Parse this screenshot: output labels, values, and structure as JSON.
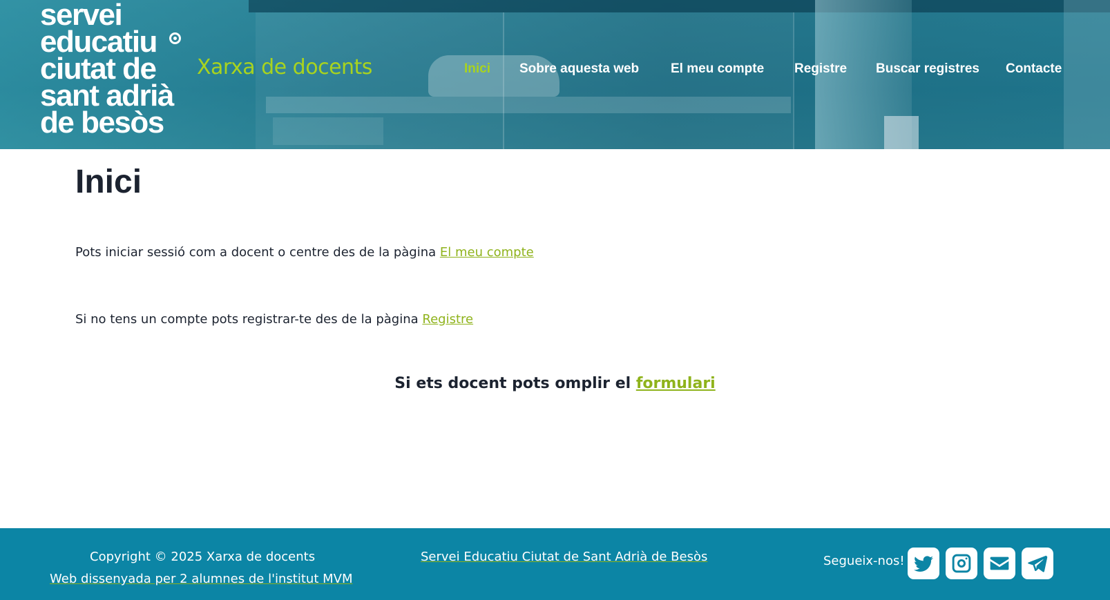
{
  "header": {
    "logo_lines": [
      "servei",
      "educatiu",
      "ciutat de",
      "sant adrià",
      "de besòs"
    ],
    "site_title": "Xarxa de docents",
    "nav": [
      {
        "label": "Inici",
        "active": true
      },
      {
        "label": "Sobre aquesta web",
        "active": false
      },
      {
        "label": "El meu compte",
        "active": false
      },
      {
        "label": "Registre",
        "active": false
      },
      {
        "label": "Buscar registres",
        "active": false
      },
      {
        "label": "Contacte",
        "active": false
      }
    ]
  },
  "main": {
    "title": "Inici",
    "para1_text": "Pots iniciar sessió com a docent o centre des de la pàgina ",
    "para1_link": "El meu compte",
    "para2_text": "Si no tens un compte pots registrar-te des de la pàgina ",
    "para2_link": "Registre",
    "cta_text": "Si ets docent pots omplir el ",
    "cta_link": "formulari"
  },
  "footer": {
    "copyright": "Copyright © 2025 Xarxa de docents",
    "credit": "Web dissenyada per 2 alumnes de l'institut MVM",
    "center_link": "Servei Educatiu Ciutat de Sant Adrià de Besòs",
    "follow_label": "Segueix-nos!",
    "social_icons": [
      "twitter-icon",
      "instagram-icon",
      "email-icon",
      "telegram-icon"
    ]
  },
  "colors": {
    "accent_green": "#a8d31f",
    "link_green": "#8fb31c",
    "footer_blue": "#0c85a5",
    "text_dark": "#1c2330"
  }
}
